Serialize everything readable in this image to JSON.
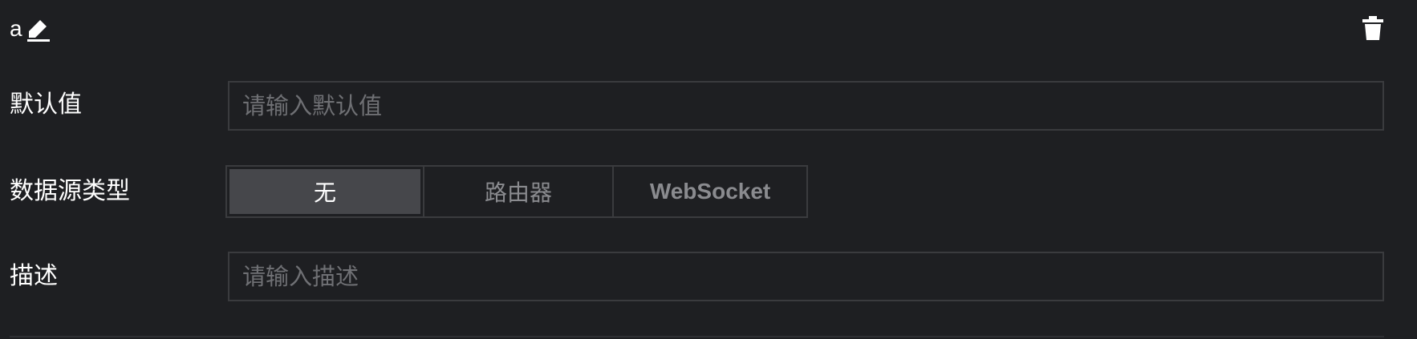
{
  "header": {
    "variable_name": "a",
    "edit_icon": "pencil-icon",
    "delete_icon": "trash-icon"
  },
  "default_value": {
    "label": "默认值",
    "placeholder": "请输入默认值",
    "value": ""
  },
  "data_source_type": {
    "label": "数据源类型",
    "options": [
      "无",
      "路由器",
      "WebSocket"
    ],
    "selected": "无"
  },
  "description": {
    "label": "描述",
    "placeholder": "请输入描述",
    "value": ""
  },
  "colors": {
    "background": "#1e1f22",
    "border": "#3a3b3e",
    "segment_active": "#46474b",
    "placeholder": "#6f7074"
  }
}
